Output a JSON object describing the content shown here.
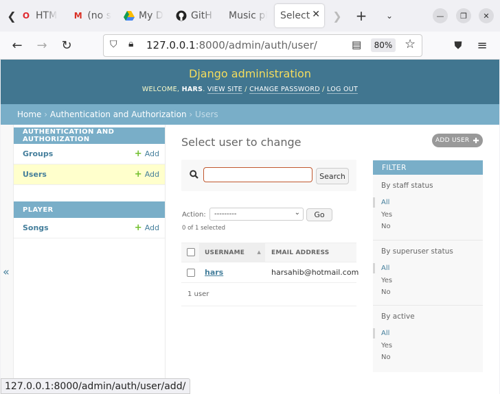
{
  "browser": {
    "tabs": [
      {
        "label": "HTM",
        "icon": "opera-icon"
      },
      {
        "label": "(no s",
        "icon": "gmail-icon"
      },
      {
        "label": "My D",
        "icon": "drive-icon"
      },
      {
        "label": "GitH",
        "icon": "github-icon"
      },
      {
        "label": "Music pl",
        "icon": "none"
      },
      {
        "label": "Select",
        "icon": "none",
        "active": true
      }
    ],
    "url_host": "127.0.0.1",
    "url_rest": ":8000/admin/auth/user/",
    "zoom": "80%",
    "status_url": "127.0.0.1:8000/admin/auth/user/add/"
  },
  "header": {
    "site_name": "Django administration",
    "welcome": "WELCOME,",
    "username": "HARS",
    "view_site": "VIEW SITE",
    "change_password": "CHANGE PASSWORD",
    "log_out": "LOG OUT",
    "sep": "/"
  },
  "breadcrumbs": {
    "home": "Home",
    "app": "Authentication and Authorization",
    "current": "Users",
    "sep": "›"
  },
  "sidebar": {
    "modules": [
      {
        "caption": "AUTHENTICATION AND AUTHORIZATION",
        "models": [
          {
            "name": "Groups",
            "add": "Add"
          },
          {
            "name": "Users",
            "add": "Add",
            "current": true
          }
        ]
      },
      {
        "caption": "PLAYER",
        "models": [
          {
            "name": "Songs",
            "add": "Add"
          }
        ]
      }
    ],
    "toggle": "«"
  },
  "main": {
    "title": "Select user to change",
    "add_user": "ADD USER",
    "search": {
      "value": "",
      "placeholder": "",
      "button": "Search"
    },
    "action": {
      "label": "Action:",
      "selected": "---------",
      "go": "Go",
      "count": "0 of 1 selected"
    },
    "table": {
      "columns": [
        "USERNAME",
        "EMAIL ADDRESS"
      ],
      "rows": [
        {
          "username": "hars",
          "email": "harsahib@hotmail.com"
        }
      ],
      "paginator": "1 user"
    }
  },
  "filter": {
    "title": "FILTER",
    "sections": [
      {
        "title": "By staff status",
        "options": [
          "All",
          "Yes",
          "No"
        ],
        "selected": "All"
      },
      {
        "title": "By superuser status",
        "options": [
          "All",
          "Yes",
          "No"
        ],
        "selected": "All"
      },
      {
        "title": "By active",
        "options": [
          "All",
          "Yes",
          "No"
        ],
        "selected": "All"
      }
    ]
  },
  "colors": {
    "header": "#417690",
    "breadcrumbs": "#79aec8",
    "site_name": "#f5dd5d",
    "link": "#447e9b",
    "add_plus": "#70bf2b",
    "current_row": "#ffffcc"
  }
}
